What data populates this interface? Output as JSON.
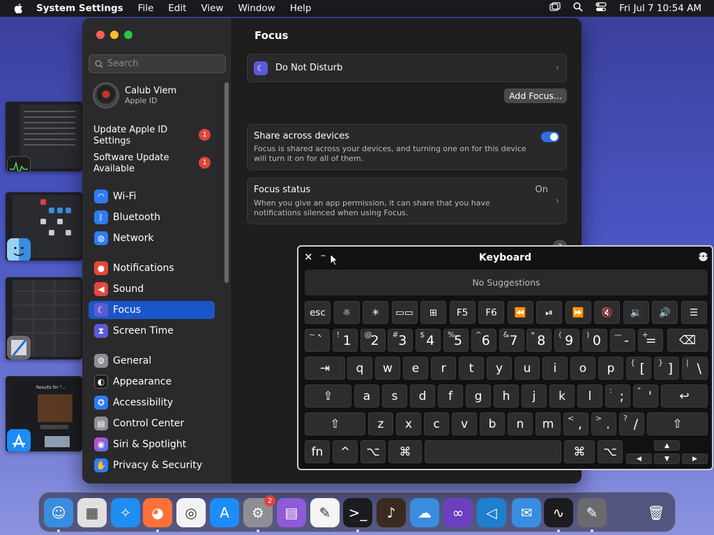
{
  "menubar": {
    "app_name": "System Settings",
    "menus": [
      "File",
      "Edit",
      "View",
      "Window",
      "Help"
    ],
    "clock": "Fri Jul 7  10:54 AM"
  },
  "sidebar": {
    "search_placeholder": "Search",
    "profile": {
      "name": "Calub Viem",
      "subtitle": "Apple ID"
    },
    "notices": [
      {
        "label": "Update Apple ID Settings",
        "badge": "1"
      },
      {
        "label": "Software Update Available",
        "badge": "1"
      }
    ],
    "items": [
      {
        "label": "Wi-Fi",
        "icon": "wifi-icon",
        "color": "#2f7bf5"
      },
      {
        "label": "Bluetooth",
        "icon": "bluetooth-icon",
        "color": "#2f7bf5"
      },
      {
        "label": "Network",
        "icon": "globe-icon",
        "color": "#2f7bf5"
      },
      {
        "label": "Notifications",
        "icon": "bell-icon",
        "color": "#e5473c"
      },
      {
        "label": "Sound",
        "icon": "speaker-icon",
        "color": "#e5473c"
      },
      {
        "label": "Focus",
        "icon": "moon-icon",
        "color": "#5b5bd6"
      },
      {
        "label": "Screen Time",
        "icon": "hourglass-icon",
        "color": "#5b5bd6"
      },
      {
        "label": "General",
        "icon": "gear-icon",
        "color": "#8e8e93"
      },
      {
        "label": "Appearance",
        "icon": "appearance-icon",
        "color": "#1c1c1e"
      },
      {
        "label": "Accessibility",
        "icon": "accessibility-icon",
        "color": "#2f7bf5"
      },
      {
        "label": "Control Center",
        "icon": "control-center-icon",
        "color": "#8e8e93"
      },
      {
        "label": "Siri & Spotlight",
        "icon": "siri-icon",
        "color": "#8a3ff0"
      },
      {
        "label": "Privacy & Security",
        "icon": "hand-icon",
        "color": "#2f7bf5"
      }
    ],
    "selected": "Focus"
  },
  "main": {
    "title": "Focus",
    "dnd_label": "Do Not Disturb",
    "add_focus_label": "Add Focus...",
    "share": {
      "title": "Share across devices",
      "desc": "Focus is shared across your devices, and turning one on for this device will turn it on for all of them.",
      "enabled": true
    },
    "status": {
      "title": "Focus status",
      "value": "On",
      "desc": "When you give an app permission, it can share that you have notifications silenced when using Focus."
    },
    "help": "?"
  },
  "keyboard": {
    "title": "Keyboard",
    "suggestions": "No Suggestions",
    "fn_row": [
      "esc",
      "☼",
      "☀",
      "▭▭",
      "⊞",
      "F5",
      "F6",
      "⏪",
      "⏯",
      "⏩",
      "🔇",
      "🔉",
      "🔊",
      "☰"
    ],
    "num_row": [
      [
        "~",
        "`"
      ],
      [
        "!",
        "1"
      ],
      [
        "@",
        "2"
      ],
      [
        "#",
        "3"
      ],
      [
        "$",
        "4"
      ],
      [
        "%",
        "5"
      ],
      [
        "^",
        "6"
      ],
      [
        "&",
        "7"
      ],
      [
        "*",
        "8"
      ],
      [
        "(",
        "9"
      ],
      [
        ")",
        "0"
      ],
      [
        "—",
        "-"
      ],
      [
        "+",
        "="
      ]
    ],
    "row_q": [
      "q",
      "w",
      "e",
      "r",
      "t",
      "y",
      "u",
      "i",
      "o",
      "p"
    ],
    "row_q_sym": [
      [
        "{",
        "["
      ],
      [
        "}",
        "]"
      ],
      [
        "|",
        "\\"
      ]
    ],
    "row_a": [
      "a",
      "s",
      "d",
      "f",
      "g",
      "h",
      "j",
      "k",
      "l"
    ],
    "row_a_sym": [
      [
        ":",
        ";"
      ],
      [
        "\"",
        "'"
      ]
    ],
    "row_z": [
      "z",
      "x",
      "c",
      "v",
      "b",
      "n",
      "m"
    ],
    "row_z_sym": [
      [
        "<",
        ","
      ],
      [
        ">",
        "."
      ],
      [
        "?",
        "/"
      ]
    ],
    "mods": {
      "fn": "fn",
      "ctrl": "^",
      "opt": "⌥",
      "cmd": "⌘",
      "tab": "⇥",
      "caps": "⇪",
      "shift": "⇧",
      "ret": "↩",
      "del": "⌫"
    },
    "arrows": {
      "up": "▲",
      "left": "◀",
      "down": "▼",
      "right": "▶"
    }
  },
  "dock": {
    "apps": [
      {
        "name": "Finder",
        "icon": "finder-icon",
        "color": "#3a8dde",
        "running": true
      },
      {
        "name": "Launchpad",
        "icon": "launchpad-icon",
        "color": "#e0e0e0",
        "running": false
      },
      {
        "name": "Safari",
        "icon": "safari-icon",
        "color": "#1f8ef1",
        "running": false
      },
      {
        "name": "Firefox",
        "icon": "firefox-icon",
        "color": "#ff7139",
        "running": true
      },
      {
        "name": "Chrome",
        "icon": "chrome-icon",
        "color": "#f2f2f2",
        "running": false
      },
      {
        "name": "App Store",
        "icon": "appstore-icon",
        "color": "#1d8cf8",
        "running": false
      },
      {
        "name": "System Settings",
        "icon": "settings-icon",
        "color": "#8e8e93",
        "running": true,
        "badge": "2"
      },
      {
        "name": "Apple Configurator",
        "icon": "configurator-icon",
        "color": "#8f5bd6",
        "running": false
      },
      {
        "name": "TextEdit",
        "icon": "textedit-icon",
        "color": "#f5f5f5",
        "running": false
      },
      {
        "name": "Terminal",
        "icon": "terminal-icon",
        "color": "#1c1c1e",
        "running": true
      },
      {
        "name": "GarageBand",
        "icon": "guitar-icon",
        "color": "#3a2a20",
        "running": false
      },
      {
        "name": "Weather",
        "icon": "weather-icon",
        "color": "#3a8dde",
        "running": false
      },
      {
        "name": "Visual Studio",
        "icon": "visualstudio-icon",
        "color": "#6b3fc0",
        "running": false
      },
      {
        "name": "VS Code",
        "icon": "vscode-icon",
        "color": "#1f7fcf",
        "running": false
      },
      {
        "name": "Mail",
        "icon": "mail-icon",
        "color": "#3a8dde",
        "running": false
      },
      {
        "name": "Activity Monitor",
        "icon": "activity-monitor-icon",
        "color": "#1c1c1e",
        "running": true
      },
      {
        "name": "Script Editor",
        "icon": "script-editor-icon",
        "color": "#6a6a6c",
        "running": true
      },
      {
        "name": "Trash",
        "icon": "trash-icon",
        "color": "#888",
        "running": false
      }
    ]
  }
}
